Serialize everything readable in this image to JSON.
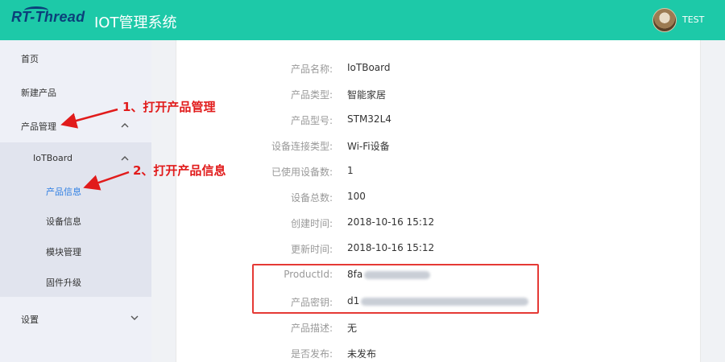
{
  "header": {
    "logo": "RT-Thread",
    "title": "IOT管理系统",
    "user": "TEST"
  },
  "sidebar": {
    "home": "首页",
    "new_product": "新建产品",
    "product_mgmt": "产品管理",
    "product_name": "IoTBoard",
    "sub_items": [
      "产品信息",
      "设备信息",
      "模块管理",
      "固件升级"
    ],
    "settings": "设置"
  },
  "product": {
    "fields": [
      {
        "label": "产品名称:",
        "value": "IoTBoard"
      },
      {
        "label": "产品类型:",
        "value": "智能家居"
      },
      {
        "label": "产品型号:",
        "value": "STM32L4"
      },
      {
        "label": "设备连接类型:",
        "value": "Wi-Fi设备"
      },
      {
        "label": "已使用设备数:",
        "value": "1"
      },
      {
        "label": "设备总数:",
        "value": "100"
      },
      {
        "label": "创建时间:",
        "value": "2018-10-16 15:12"
      },
      {
        "label": "更新时间:",
        "value": "2018-10-16 15:12"
      },
      {
        "label": "ProductId:",
        "value": "8fa"
      },
      {
        "label": "产品密钥:",
        "value": "d1"
      },
      {
        "label": "产品描述:",
        "value": "无"
      },
      {
        "label": "是否发布:",
        "value": "未发布"
      }
    ]
  },
  "annotations": {
    "step1": "1、打开产品管理",
    "step2": "2、打开产品信息"
  },
  "colors": {
    "header": "#1dc9a8",
    "accent": "#2f7fe3",
    "annotation": "#e11b1b"
  }
}
